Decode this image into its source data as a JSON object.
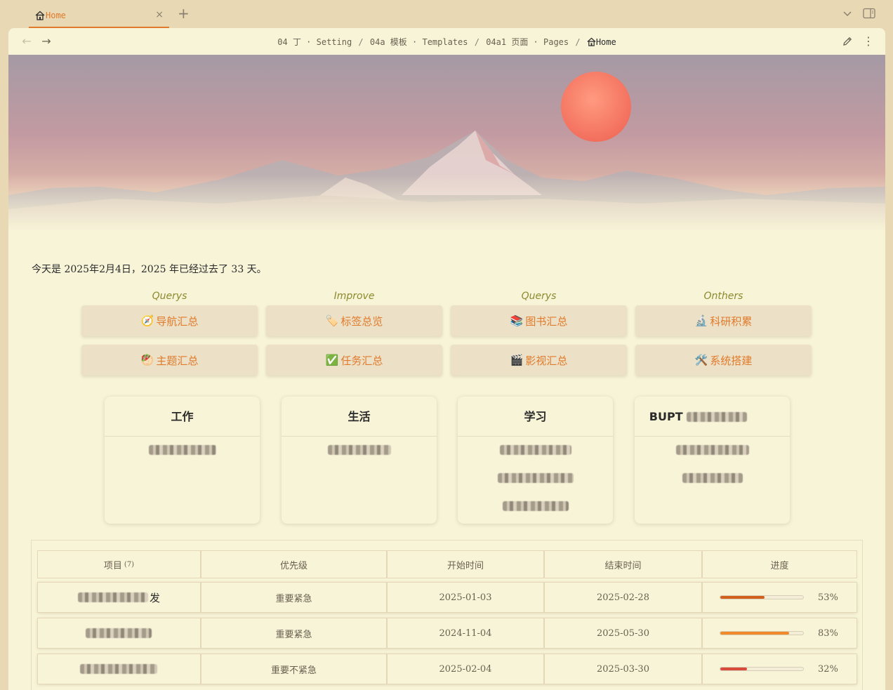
{
  "tab": {
    "title": "Home",
    "close": "×"
  },
  "tabbar": {
    "add": "+"
  },
  "nav": {
    "back": "←",
    "forward": "→"
  },
  "breadcrumb": [
    "04 丁 · Setting",
    "04a 模板 · Templates",
    "04a1 页面 · Pages"
  ],
  "breadcrumb_current": "Home",
  "breadcrumb_sep": "/",
  "more_menu": "⋮",
  "date_line": "今天是 2025年2月4日，2025 年已经过去了 33 天。",
  "columns": [
    {
      "heading": "Querys",
      "buttons": [
        {
          "icon": "🧭",
          "label": "导航汇总"
        },
        {
          "icon": "🥙",
          "label": "主题汇总"
        }
      ]
    },
    {
      "heading": "Improve",
      "buttons": [
        {
          "icon": "🏷️",
          "label": "标签总览"
        },
        {
          "icon": "✅",
          "label": "任务汇总"
        }
      ]
    },
    {
      "heading": "Querys",
      "buttons": [
        {
          "icon": "📚",
          "label": "图书汇总"
        },
        {
          "icon": "🎬",
          "label": "影视汇总"
        }
      ]
    },
    {
      "heading": "Onthers",
      "buttons": [
        {
          "icon": "🔬",
          "label": "科研积累"
        },
        {
          "icon": "🛠️",
          "label": "系统搭建"
        }
      ]
    }
  ],
  "cards": [
    {
      "title": "工作",
      "items": 1
    },
    {
      "title": "生活",
      "items": 1
    },
    {
      "title": "学习",
      "items": 3
    },
    {
      "title": "BUPT",
      "items": 2
    }
  ],
  "table": {
    "headers": [
      "项目",
      "优先级",
      "开始时间",
      "结束时间",
      "进度"
    ],
    "count": "(7)",
    "rows": [
      {
        "project_suffix": "发",
        "priority": "重要紧急",
        "start": "2025-01-03",
        "end": "2025-02-28",
        "progress": 53,
        "progress_label": "53%",
        "bar_color": "#d0601c"
      },
      {
        "project_suffix": "",
        "priority": "重要紧急",
        "start": "2024-11-04",
        "end": "2025-05-30",
        "progress": 83,
        "progress_label": "83%",
        "bar_color": "#f08a2a"
      },
      {
        "project_suffix": "",
        "priority": "重要不紧急",
        "start": "2025-02-04",
        "end": "2025-03-30",
        "progress": 32,
        "progress_label": "32%",
        "bar_color": "#d84a3a"
      }
    ]
  },
  "colors": {
    "accent": "#e07a2c",
    "background": "#f8f4d8",
    "frame": "#e8d8b4",
    "heading_olive": "#8c8a2e",
    "button_bg": "#ece1c6"
  }
}
